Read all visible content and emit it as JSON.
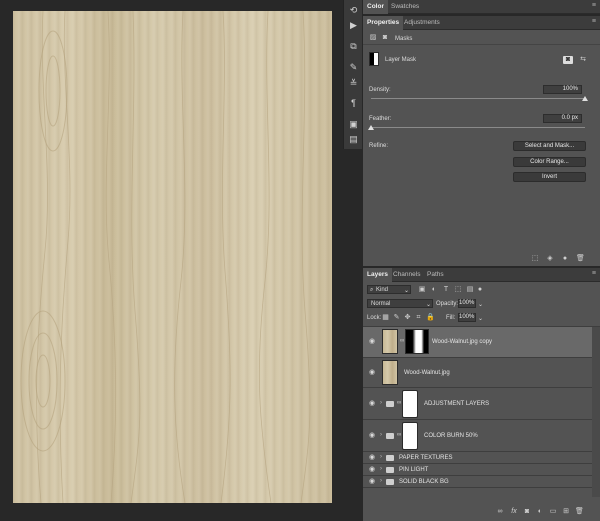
{
  "color_panel": {
    "tabs": [
      "Color",
      "Swatches"
    ]
  },
  "properties_panel": {
    "tabs": [
      "Properties",
      "Adjustments"
    ],
    "section": "Masks",
    "mask_type": "Layer Mask",
    "density_label": "Density:",
    "density_value": "100%",
    "density_level": 1.0,
    "feather_label": "Feather:",
    "feather_value": "0.0 px",
    "feather_level": 0.0,
    "refine_label": "Refine:",
    "buttons": [
      "Select and Mask...",
      "Color Range...",
      "Invert"
    ]
  },
  "layers_panel": {
    "tabs": [
      "Layers",
      "Channels",
      "Paths"
    ],
    "filter_kind": "Kind",
    "blend_mode": "Normal",
    "opacity_label": "Opacity:",
    "opacity_value": "100%",
    "lock_label": "Lock:",
    "fill_label": "Fill:",
    "fill_value": "100%",
    "layers": [
      {
        "name": "Wood-Walnut.jpg copy",
        "kind": "image-with-mask",
        "selected": true
      },
      {
        "name": "Wood-Walnut.jpg",
        "kind": "image"
      },
      {
        "name": "ADJUSTMENT LAYERS",
        "kind": "group-with-mask"
      },
      {
        "name": "COLOR BURN 50%",
        "kind": "group-with-mask"
      },
      {
        "name": "PAPER TEXTURES",
        "kind": "group"
      },
      {
        "name": "PIN LIGHT",
        "kind": "group"
      },
      {
        "name": "SOLID BLACK BG",
        "kind": "group"
      }
    ],
    "footer_icons": [
      "link-icon",
      "fx-icon",
      "add-mask-icon",
      "adjustment-icon",
      "new-group-icon",
      "new-layer-icon",
      "trash-icon"
    ]
  },
  "colors": {
    "panel_bg": "#535353",
    "selected_row": "#696969",
    "canvas_bg": "#282828"
  }
}
